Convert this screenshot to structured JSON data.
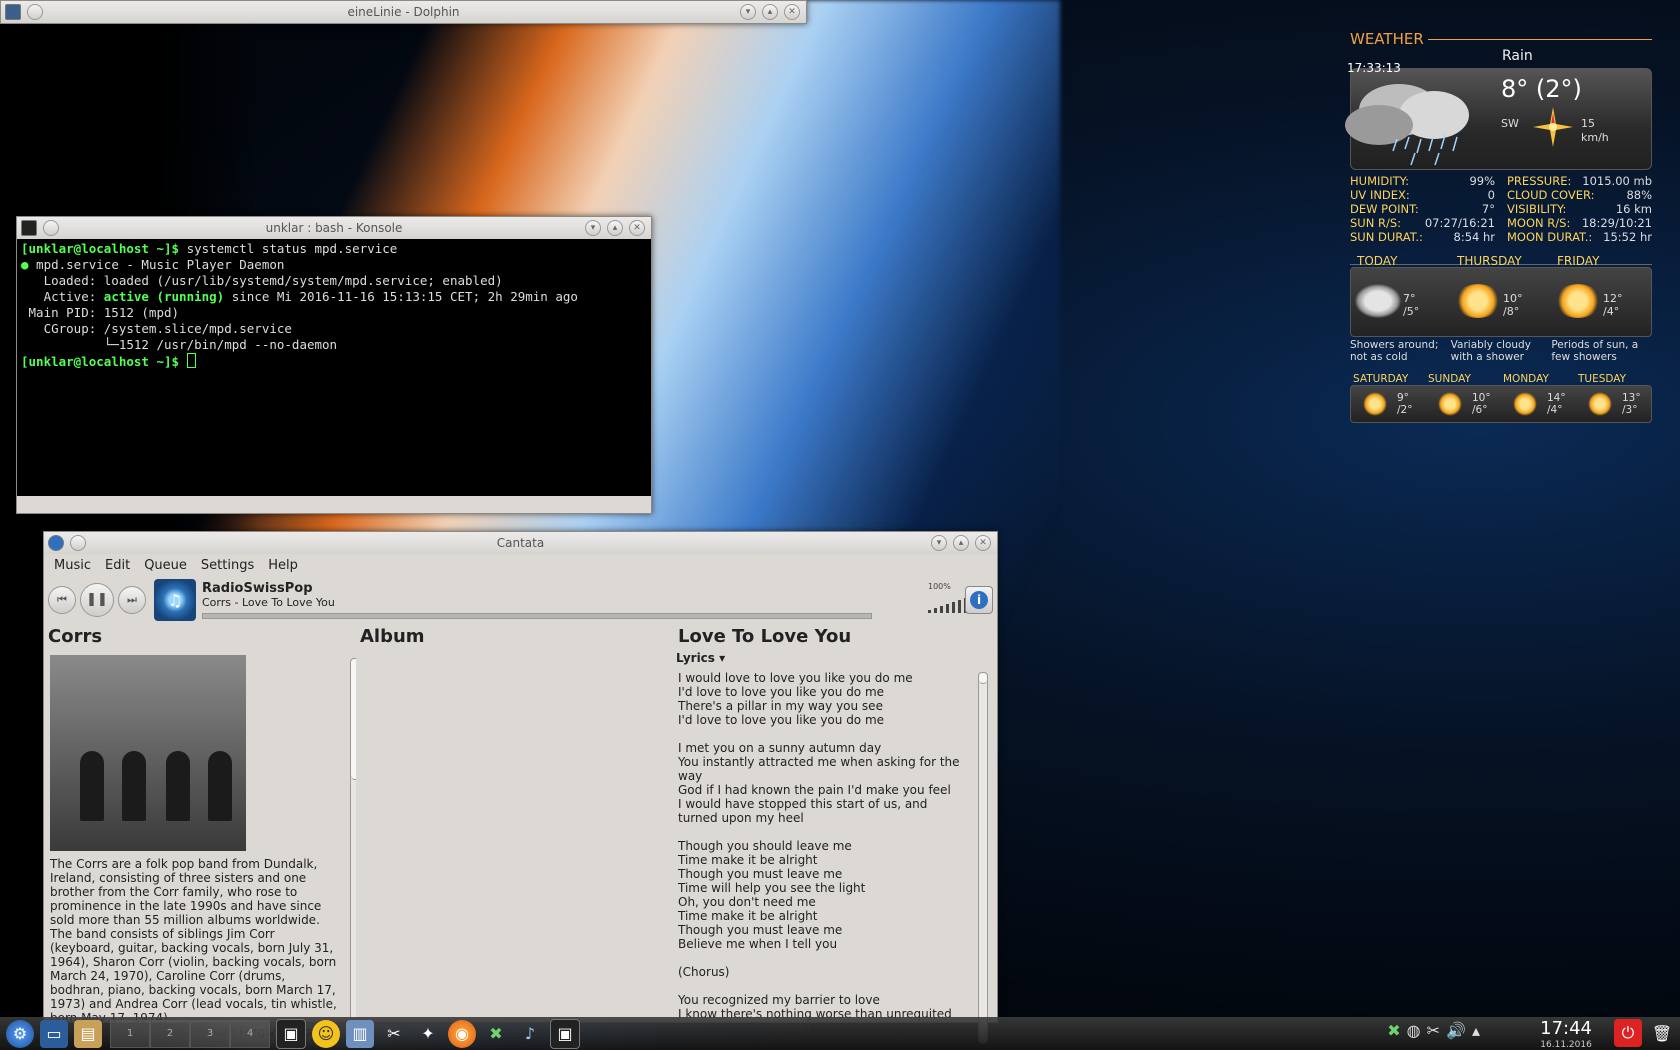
{
  "dolphin": {
    "title": "eineLinie - Dolphin"
  },
  "konsole": {
    "title": "unklar : bash - Konsole",
    "lines": [
      {
        "prompt": "[unklar@localhost ~]$",
        "text": " systemctl status mpd.service"
      },
      {
        "prompt": "●",
        "text": " mpd.service - Music Player Daemon"
      },
      {
        "prompt": "",
        "text": "   Loaded: loaded (/usr/lib/systemd/system/mpd.service; enabled)"
      },
      {
        "prompt": "",
        "text": "   Active: ",
        "hl": "active (running)",
        "after": " since Mi 2016-11-16 15:13:15 CET; 2h 29min ago"
      },
      {
        "prompt": "",
        "text": " Main PID: 1512 (mpd)"
      },
      {
        "prompt": "",
        "text": "   CGroup: /system.slice/mpd.service"
      },
      {
        "prompt": "",
        "text": "           └─1512 /usr/bin/mpd --no-daemon"
      },
      {
        "prompt": "[unklar@localhost ~]$",
        "text": " "
      }
    ]
  },
  "cantata": {
    "title": "Cantata",
    "menu": [
      "Music",
      "Edit",
      "Queue",
      "Settings",
      "Help"
    ],
    "station": "RadioSwissPop",
    "track": "Corrs - Love To Love You",
    "volume": "100%",
    "artist": {
      "heading": "Corrs",
      "bio": "The Corrs are a folk pop band from Dundalk, Ireland, consisting of three sisters and one brother from the Corr family, who rose to prominence in the late 1990s and have since sold more than 55 million albums worldwide. The band consists of siblings Jim Corr (keyboard, guitar, backing vocals, born July 31, 1964), Sharon Corr (violin, backing vocals, born March 24, 1970), Caroline Corr (drums, bodhran, piano, backing vocals, born March 17, 1973) and Andrea Corr (lead vocals, tin whistle, born May 17, 1974).\nThey released their first album Forgiven Not"
    },
    "album": {
      "heading": "Album"
    },
    "song": {
      "heading": "Love To Love You",
      "lyrics_label": "Lyrics ▾",
      "lyrics": "I would love to love you like you do me\nI'd love to love you like you do me\nThere's a pillar in my way you see\nI'd love to love you like you do me\n\nI met you on a sunny autumn day\nYou instantly attracted me when asking for the way\nGod if I had known the pain I'd make you feel\nI would have stopped this start of us, and turned upon my heel\n\nThough you should leave me\nTime make it be alright\nThough you must leave me\nTime will help you see the light\nOh, you don't need me\nTime make it be alright\nThough you must leave me\nBelieve me when I tell you\n\n(Chorus)\n\nYou recognized my barrier to love\nI know there's nothing worse than unrequited love (unrequited love)\nSo I prayed to God that I could give the love"
    }
  },
  "weather": {
    "title": "WEATHER",
    "condition": "Rain",
    "time": "17:33:13",
    "temp": "8° (2°)",
    "wind_dir": "SW",
    "wind_speed": "15",
    "wind_unit": "km/h",
    "left_stats": [
      {
        "k": "HUMIDITY:",
        "v": "99%"
      },
      {
        "k": "UV INDEX:",
        "v": "0"
      },
      {
        "k": "DEW POINT:",
        "v": "7°"
      },
      {
        "k": "SUN R/S:",
        "v": "07:27/16:21"
      },
      {
        "k": "SUN DURAT.:",
        "v": "8:54 hr"
      }
    ],
    "right_stats": [
      {
        "k": "PRESSURE:",
        "v": "1015.00 mb"
      },
      {
        "k": "CLOUD COVER:",
        "v": "88%"
      },
      {
        "k": "VISIBILITY:",
        "v": "16 km"
      },
      {
        "k": "MOON R/S:",
        "v": "18:29/10:21"
      },
      {
        "k": "MOON DURAT.:",
        "v": "15:52 hr"
      }
    ],
    "days3": [
      {
        "name": "TODAY",
        "hi": "7°",
        "lo": "/5°",
        "desc": "Showers around; not as cold"
      },
      {
        "name": "THURSDAY",
        "hi": "10°",
        "lo": "/8°",
        "desc": "Variably cloudy with a shower"
      },
      {
        "name": "FRIDAY",
        "hi": "12°",
        "lo": "/4°",
        "desc": "Periods of sun, a few showers"
      }
    ],
    "days4": [
      {
        "name": "SATURDAY",
        "hi": "9°",
        "lo": "/2°"
      },
      {
        "name": "SUNDAY",
        "hi": "10°",
        "lo": "/6°"
      },
      {
        "name": "MONDAY",
        "hi": "14°",
        "lo": "/4°"
      },
      {
        "name": "TUESDAY",
        "hi": "13°",
        "lo": "/3°"
      }
    ]
  },
  "taskbar": {
    "pager": [
      "1",
      "2",
      "3",
      "4"
    ],
    "time": "17:44",
    "date": "16.11.2016"
  }
}
